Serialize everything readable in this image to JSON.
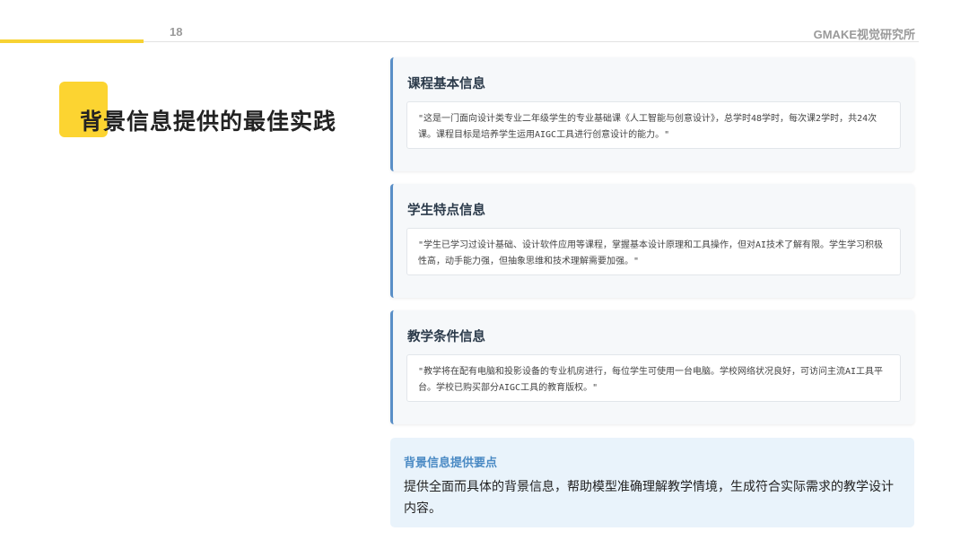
{
  "header": {
    "page_number": "18",
    "brand": "GMAKE视觉研究所"
  },
  "title": "背景信息提供的最佳实践",
  "cards": [
    {
      "title": "课程基本信息",
      "quote": "\"这是一门面向设计类专业二年级学生的专业基础课《人工智能与创意设计》，总学时48学时，每次课2学时，共24次课。课程目标是培养学生运用AIGC工具进行创意设计的能力。\""
    },
    {
      "title": "学生特点信息",
      "quote": "\"学生已学习过设计基础、设计软件应用等课程，掌握基本设计原理和工具操作，但对AI技术了解有限。学生学习积极性高，动手能力强，但抽象思维和技术理解需要加强。\""
    },
    {
      "title": "教学条件信息",
      "quote": "\"教学将在配有电脑和投影设备的专业机房进行，每位学生可使用一台电脑。学校网络状况良好，可访问主流AI工具平台。学校已购买部分AIGC工具的教育版权。\""
    }
  ],
  "tip": {
    "title": "背景信息提供要点",
    "body": "提供全面而具体的背景信息，帮助模型准确理解教学情境，生成符合实际需求的教学设计内容。"
  },
  "colors": {
    "accent_yellow": "#f7d233",
    "card_border_blue": "#5a8fc7",
    "tip_background": "#e9f3fb",
    "tip_title": "#4a8ac4"
  }
}
